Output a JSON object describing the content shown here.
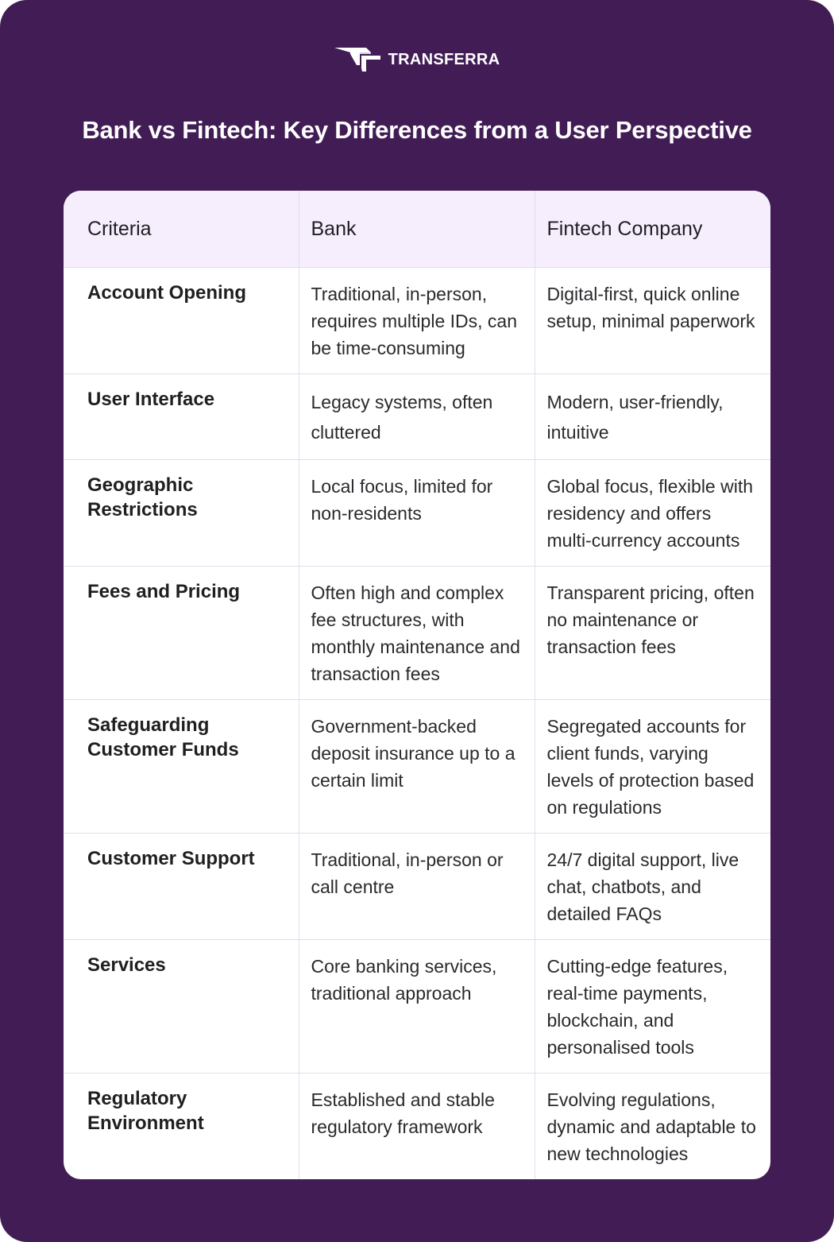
{
  "brand": {
    "name": "TRANSFERRA",
    "logo_icon": "transferra-tf-logo-icon"
  },
  "title": "Bank vs Fintech: Key Differences from a User Perspective",
  "colors": {
    "background": "#421d55",
    "header_row": "#f6eefd",
    "border": "#e4dcef",
    "text": "#1f1f22"
  },
  "table": {
    "headers": [
      "Criteria",
      "Bank",
      "Fintech Company"
    ],
    "rows": [
      {
        "criteria": "Account Opening",
        "bank": "Traditional, in-person, requires multiple IDs, can be time-consuming",
        "fintech": "Digital-first, quick online setup, minimal paperwork"
      },
      {
        "criteria": "User Interface",
        "bank": "Legacy systems, often cluttered",
        "fintech": "Modern, user-friendly, intuitive"
      },
      {
        "criteria": "Geographic Restrictions",
        "bank": "Local focus, limited for non-residents",
        "fintech": "Global focus, flexible with residency and offers multi-currency accounts"
      },
      {
        "criteria": "Fees and Pricing",
        "bank": "Often high and complex fee structures, with monthly maintenance and transaction fees",
        "fintech": "Transparent pricing, often no maintenance or transaction fees"
      },
      {
        "criteria": "Safeguarding Customer Funds",
        "bank": "Government-backed deposit insurance up to a certain limit",
        "fintech": "Segregated accounts for client funds, varying levels of protection based on regulations"
      },
      {
        "criteria": "Customer Support",
        "bank": "Traditional, in-person or call centre",
        "fintech": "24/7 digital support, live chat, chatbots, and detailed FAQs"
      },
      {
        "criteria": "Services",
        "bank": "Core banking services, traditional approach",
        "fintech": "Cutting-edge features, real-time payments, blockchain, and personalised tools"
      },
      {
        "criteria": "Regulatory Environment",
        "bank": "Established and stable regulatory framework",
        "fintech": "Evolving regulations, dynamic and adaptable to new technologies"
      }
    ]
  }
}
